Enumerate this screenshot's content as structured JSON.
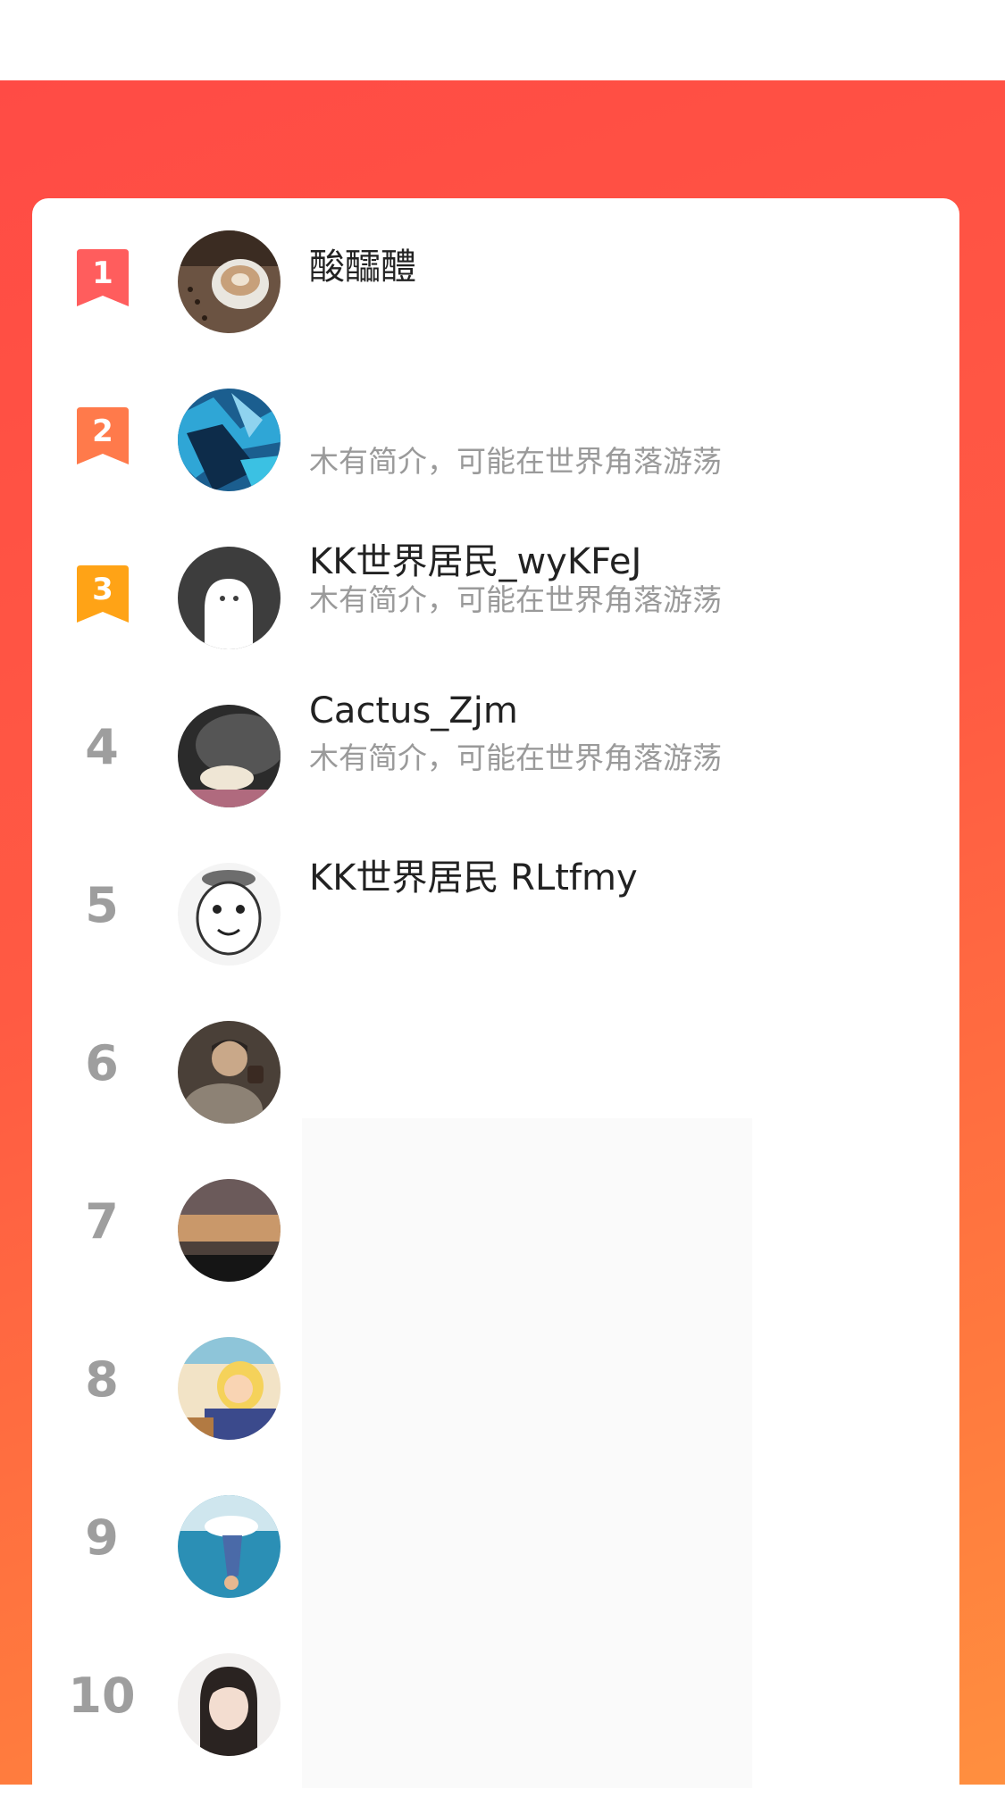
{
  "ranking": {
    "rows": [
      {
        "rank": "1",
        "name": "酸醽醴",
        "intro": "",
        "badge_color": "#ff5d5d",
        "avatar": "coffee-avatar"
      },
      {
        "rank": "2",
        "name": "",
        "intro": "木有简介，可能在世界角落游荡",
        "badge_color": "#ff7a4b",
        "avatar": "abstract-avatar"
      },
      {
        "rank": "3",
        "name": "KK世界居民_wyKFeJ",
        "intro": "木有简介，可能在世界角落游荡",
        "badge_color": "#ffa316",
        "avatar": "default-ghost-avatar"
      },
      {
        "rank": "4",
        "name": "Cactus_Zjm",
        "intro": "木有简介，可能在世界角落游荡",
        "badge_color": "",
        "avatar": "cat-avatar"
      },
      {
        "rank": "5",
        "name": "KK世界居民 RLtfmy",
        "intro": "",
        "badge_color": "",
        "avatar": "cartoon-avatar"
      },
      {
        "rank": "6",
        "name": "",
        "intro": "",
        "badge_color": "",
        "avatar": "person-avatar"
      },
      {
        "rank": "7",
        "name": "",
        "intro": "",
        "badge_color": "",
        "avatar": "sunset-avatar"
      },
      {
        "rank": "8",
        "name": "",
        "intro": "",
        "badge_color": "",
        "avatar": "anime-avatar"
      },
      {
        "rank": "9",
        "name": "",
        "intro": "",
        "badge_color": "",
        "avatar": "underwater-avatar"
      },
      {
        "rank": "10",
        "name": "",
        "intro": "",
        "badge_color": "",
        "avatar": "girl-avatar"
      }
    ]
  }
}
